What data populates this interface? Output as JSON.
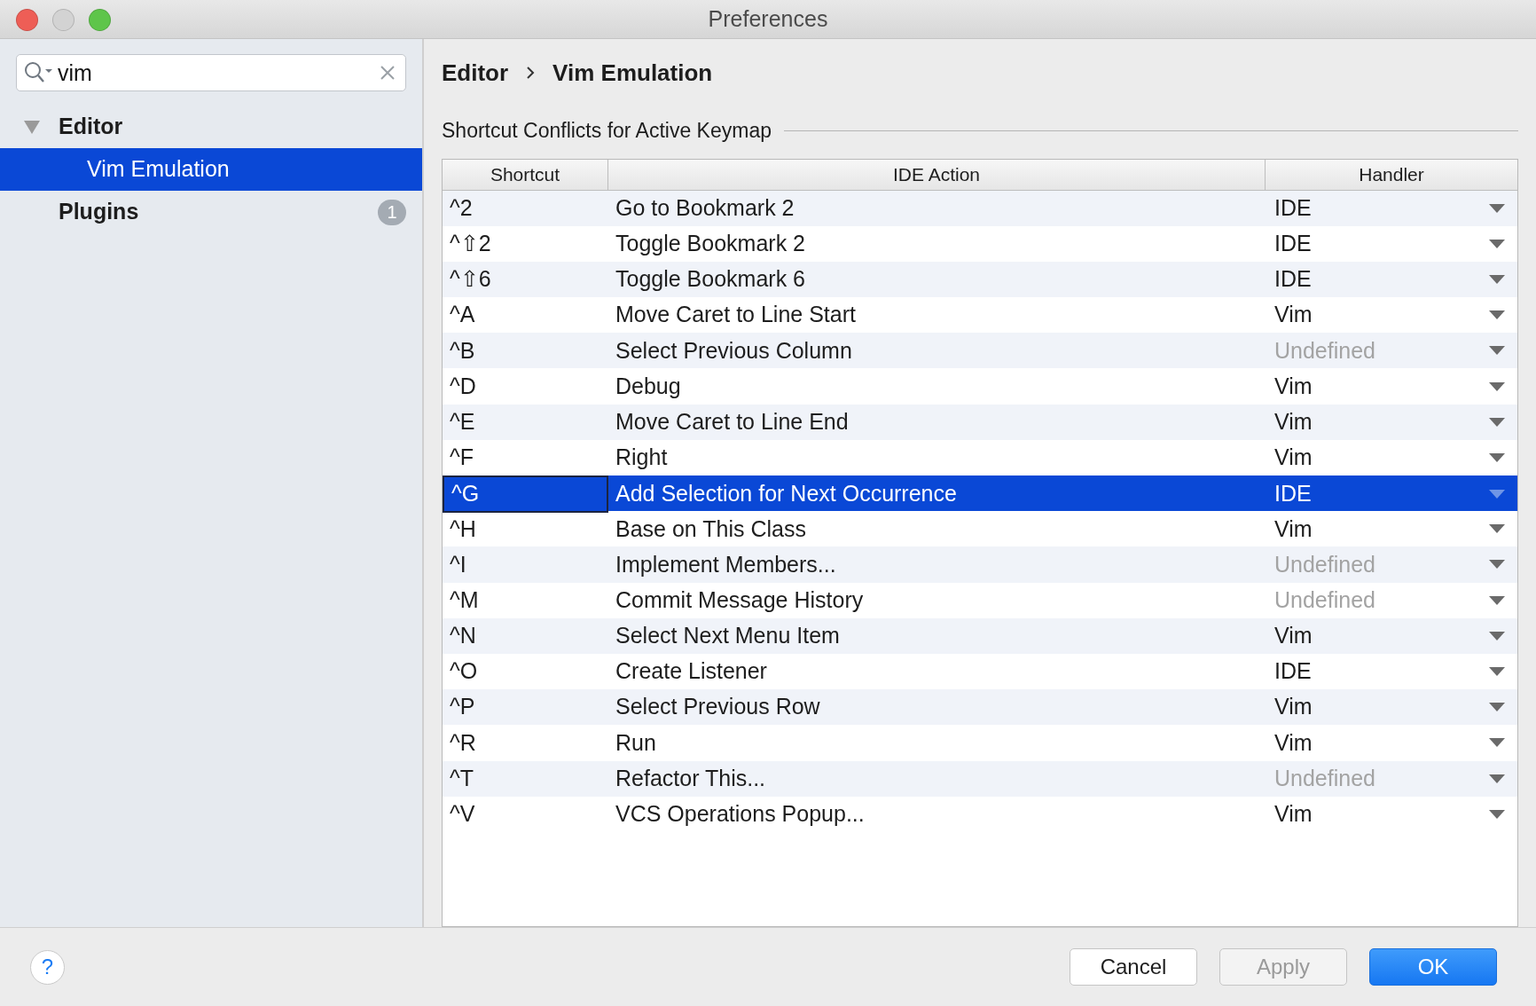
{
  "window": {
    "title": "Preferences",
    "controls": [
      {
        "kind": "close",
        "disabled": false
      },
      {
        "kind": "minimize",
        "disabled": true
      },
      {
        "kind": "zoom",
        "disabled": false
      }
    ]
  },
  "search": {
    "value": "vim"
  },
  "sidebar": {
    "items": [
      {
        "label": "Editor",
        "expanded": true,
        "selected": false,
        "children": [
          {
            "label": "Vim Emulation",
            "selected": true
          }
        ]
      },
      {
        "label": "Plugins",
        "selected": false,
        "badge": "1"
      }
    ]
  },
  "breadcrumb": [
    "Editor",
    "Vim Emulation"
  ],
  "section_title": "Shortcut Conflicts for Active Keymap",
  "table": {
    "columns": [
      "Shortcut",
      "IDE Action",
      "Handler"
    ],
    "rows": [
      {
        "shortcut": "^2",
        "action": "Go to Bookmark 2",
        "handler": "IDE",
        "dimmed": false,
        "selected": false
      },
      {
        "shortcut": "^⇧2",
        "action": "Toggle Bookmark 2",
        "handler": "IDE",
        "dimmed": false,
        "selected": false
      },
      {
        "shortcut": "^⇧6",
        "action": "Toggle Bookmark 6",
        "handler": "IDE",
        "dimmed": false,
        "selected": false
      },
      {
        "shortcut": "^A",
        "action": "Move Caret to Line Start",
        "handler": "Vim",
        "dimmed": false,
        "selected": false
      },
      {
        "shortcut": "^B",
        "action": "Select Previous Column",
        "handler": "Undefined",
        "dimmed": true,
        "selected": false
      },
      {
        "shortcut": "^D",
        "action": "Debug",
        "handler": "Vim",
        "dimmed": false,
        "selected": false
      },
      {
        "shortcut": "^E",
        "action": "Move Caret to Line End",
        "handler": "Vim",
        "dimmed": false,
        "selected": false
      },
      {
        "shortcut": "^F",
        "action": "Right",
        "handler": "Vim",
        "dimmed": false,
        "selected": false
      },
      {
        "shortcut": "^G",
        "action": "Add Selection for Next Occurrence",
        "handler": "IDE",
        "dimmed": false,
        "selected": true
      },
      {
        "shortcut": "^H",
        "action": "Base on This Class",
        "handler": "Vim",
        "dimmed": false,
        "selected": false
      },
      {
        "shortcut": "^I",
        "action": "Implement Members...",
        "handler": "Undefined",
        "dimmed": true,
        "selected": false
      },
      {
        "shortcut": "^M",
        "action": "Commit Message History",
        "handler": "Undefined",
        "dimmed": true,
        "selected": false
      },
      {
        "shortcut": "^N",
        "action": "Select Next Menu Item",
        "handler": "Vim",
        "dimmed": false,
        "selected": false
      },
      {
        "shortcut": "^O",
        "action": "Create Listener",
        "handler": "IDE",
        "dimmed": false,
        "selected": false
      },
      {
        "shortcut": "^P",
        "action": "Select Previous Row",
        "handler": "Vim",
        "dimmed": false,
        "selected": false
      },
      {
        "shortcut": "^R",
        "action": "Run",
        "handler": "Vim",
        "dimmed": false,
        "selected": false
      },
      {
        "shortcut": "^T",
        "action": "Refactor This...",
        "handler": "Undefined",
        "dimmed": true,
        "selected": false
      },
      {
        "shortcut": "^V",
        "action": "VCS Operations Popup...",
        "handler": "Vim",
        "dimmed": false,
        "selected": false
      }
    ]
  },
  "help_button": "?",
  "buttons": [
    {
      "label": "Cancel",
      "kind": "default",
      "disabled": false
    },
    {
      "label": "Apply",
      "kind": "default",
      "disabled": true
    },
    {
      "label": "OK",
      "kind": "primary",
      "disabled": false
    }
  ]
}
